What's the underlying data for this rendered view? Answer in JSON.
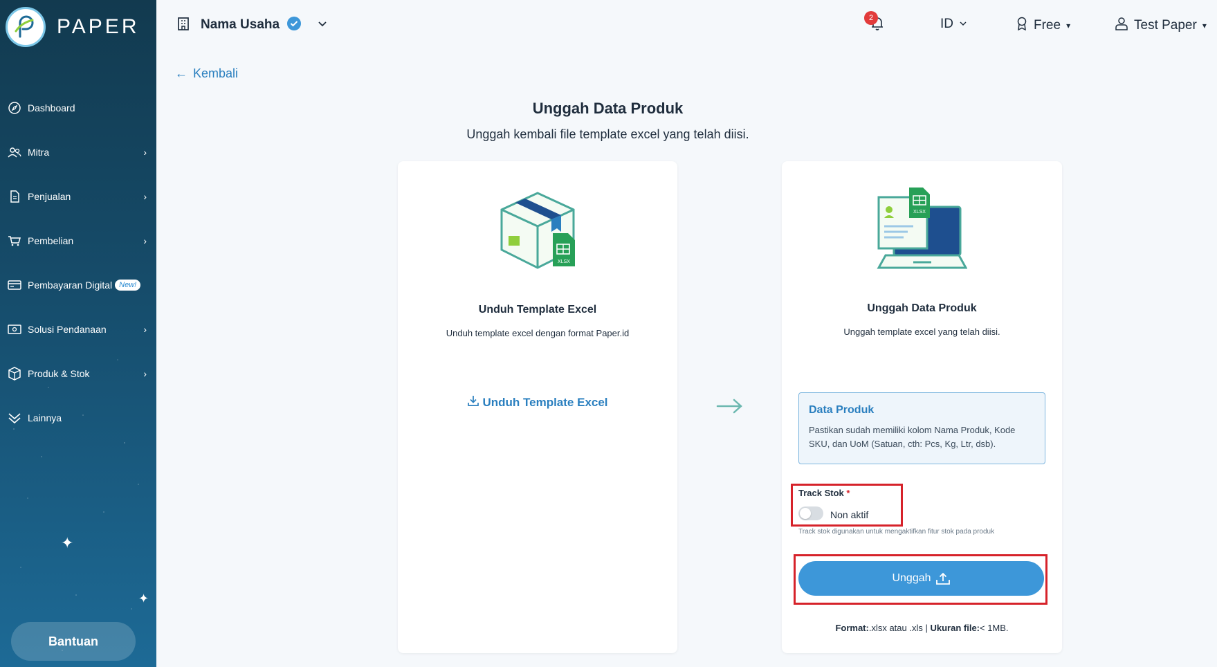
{
  "app": {
    "logo_text": "PAPER"
  },
  "sidebar": {
    "items": [
      {
        "label": "Dashboard",
        "icon": "compass-icon",
        "has_chevron": false
      },
      {
        "label": "Mitra",
        "icon": "users-icon",
        "has_chevron": true
      },
      {
        "label": "Penjualan",
        "icon": "document-icon",
        "has_chevron": true
      },
      {
        "label": "Pembelian",
        "icon": "cart-icon",
        "has_chevron": true
      },
      {
        "label": "Pembayaran Digital",
        "icon": "card-icon",
        "badge": "New!"
      },
      {
        "label": "Solusi Pendanaan",
        "icon": "money-icon",
        "has_chevron": true
      },
      {
        "label": "Produk & Stok",
        "icon": "box-icon",
        "has_chevron": true
      },
      {
        "label": "Lainnya",
        "icon": "double-chevron-down-icon",
        "has_chevron": false
      }
    ],
    "help_label": "Bantuan"
  },
  "header": {
    "business_name": "Nama Usaha",
    "notification_count": "2",
    "language": "ID",
    "plan": "Free",
    "user": "Test Paper"
  },
  "main": {
    "back_label": "Kembali",
    "title": "Unggah Data Produk",
    "subtitle": "Unggah kembali file template excel yang telah diisi.",
    "left_card": {
      "title": "Unduh Template Excel",
      "description": "Unduh template excel dengan format Paper.id",
      "link_label": "Unduh Template Excel",
      "file_badge": "XLSX"
    },
    "right_card": {
      "title": "Unggah Data Produk",
      "description": "Unggah template excel yang telah diisi.",
      "file_badge": "XLSX",
      "info_title": "Data Produk",
      "info_text": "Pastikan sudah memiliki kolom Nama Produk, Kode SKU, dan UoM (Satuan, cth: Pcs, Kg, Ltr, dsb).",
      "track_label": "Track Stok",
      "track_required": "*",
      "track_state": "Non aktif",
      "track_help": "Track stok digunakan untuk mengaktifkan fitur stok pada produk",
      "upload_label": "Unggah",
      "format_label": "Format:",
      "format_value": ".xlsx atau .xls | ",
      "size_label": "Ukuran file:",
      "size_value": "< 1MB."
    }
  },
  "colors": {
    "accent": "#3d97d9",
    "link": "#2a7fbf",
    "highlight": "#d6222a",
    "sidebar": "#164d6c"
  }
}
